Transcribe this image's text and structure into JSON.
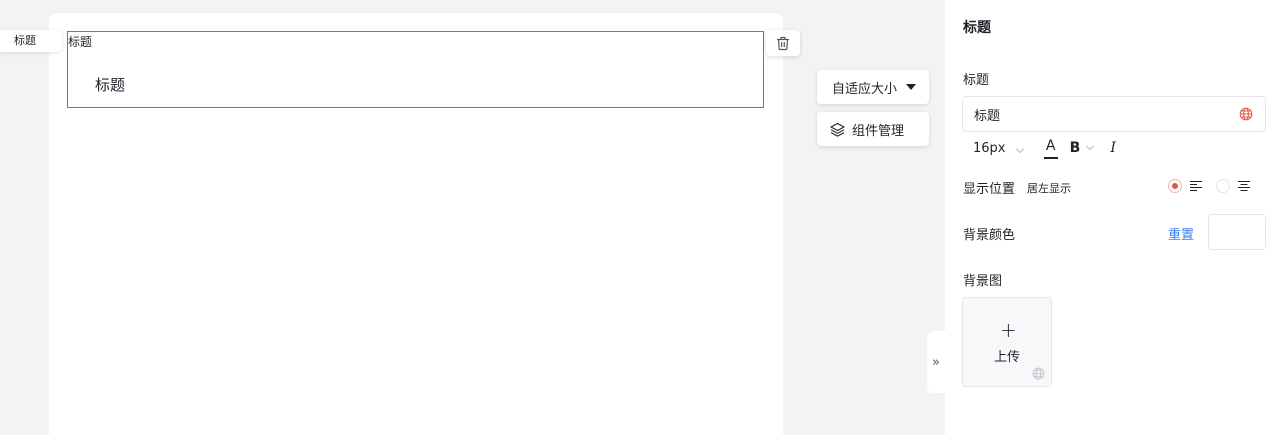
{
  "canvas": {
    "side_tag": "标题",
    "widget": {
      "caption": "标题",
      "text": "标题"
    }
  },
  "toolbar": {
    "size_label": "自适应大小",
    "manage_label": "组件管理"
  },
  "collapse_glyph": "»",
  "panel": {
    "header": "标题",
    "title_label": "标题",
    "title_value": "标题",
    "font_size": "16px",
    "font_color_glyph": "A",
    "bold_glyph": "B",
    "italic_glyph": "I",
    "position_label": "显示位置",
    "position_value": "居左显示",
    "position_options": [
      {
        "icon": "align-left-icon",
        "selected": true
      },
      {
        "icon": "align-center-icon",
        "selected": false
      }
    ],
    "bg_color_label": "背景颜色",
    "reset_label": "重置",
    "bg_color_value": "#ffffff",
    "bg_image_label": "背景图",
    "upload_plus": "+",
    "upload_label": "上传"
  },
  "colors": {
    "accent": "#3a7ef0",
    "radio_selected": "#e0584a",
    "page_bg": "#f2f3f5"
  }
}
